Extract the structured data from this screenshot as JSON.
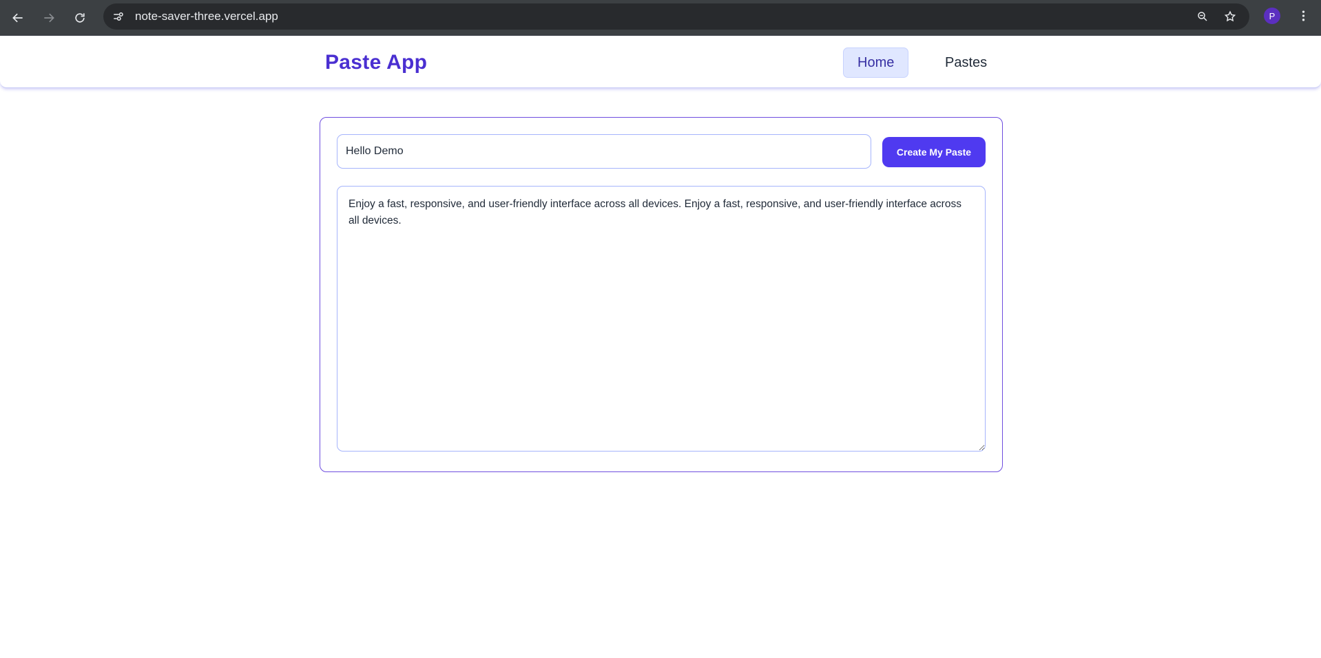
{
  "browser": {
    "url": "note-saver-three.vercel.app",
    "profile_initial": "P",
    "icons": [
      "back-arrow-icon",
      "forward-arrow-icon",
      "reload-icon",
      "site-info-icon",
      "zoom-icon",
      "star-icon",
      "kebab-menu-icon"
    ]
  },
  "navbar": {
    "brand": "Paste App",
    "links": [
      {
        "label": "Home",
        "active": true
      },
      {
        "label": "Pastes",
        "active": false
      }
    ]
  },
  "editor": {
    "title_value": "Hello Demo",
    "create_button_label": "Create My Paste",
    "content_value": "Enjoy a fast, responsive, and user-friendly interface across all devices. Enjoy a fast, responsive, and user-friendly interface across all devices."
  },
  "colors": {
    "brand": "#4a2fd1",
    "accent_button": "#4f3af0",
    "card_border": "#6d4cdf",
    "input_border": "#a5b4fc",
    "active_nav_bg": "#e0e7ff"
  }
}
